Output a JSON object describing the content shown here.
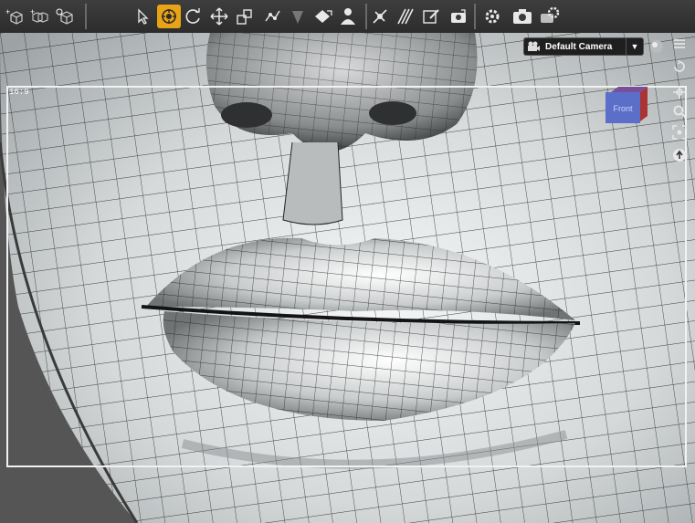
{
  "toolbar": {
    "buttons": [
      {
        "name": "new-node-icon"
      },
      {
        "name": "add-node-icon"
      },
      {
        "name": "node-settings-icon"
      },
      {
        "name": "select-arrow-icon"
      },
      {
        "name": "active-pose-icon"
      },
      {
        "name": "rotate-icon"
      },
      {
        "name": "translate-icon"
      },
      {
        "name": "scale-icon"
      },
      {
        "name": "joint-editor-icon"
      },
      {
        "name": "geometry-sculpt-icon"
      },
      {
        "name": "surface-selection-icon"
      },
      {
        "name": "figure-setup-icon"
      },
      {
        "name": "spot-render-icon"
      },
      {
        "name": "texture-shift-icon"
      },
      {
        "name": "node-weight-brush-icon"
      },
      {
        "name": "render-settings-icon"
      },
      {
        "name": "render-camera-icon"
      },
      {
        "name": "render-options-icon"
      }
    ],
    "active_index": 4,
    "active_color": "#e8a317"
  },
  "viewport": {
    "camera_label": "Default Camera",
    "camera_dropdown_arrow": "▼",
    "aspect_ratio_label": "16:9",
    "frame_color": "#f2f2f2",
    "cube_face_label": "Front",
    "side_controls": [
      "viewport-options-icon",
      "orbit-icon",
      "pan-icon",
      "zoom-icon",
      "frame-icon",
      "reset-view-icon"
    ]
  }
}
